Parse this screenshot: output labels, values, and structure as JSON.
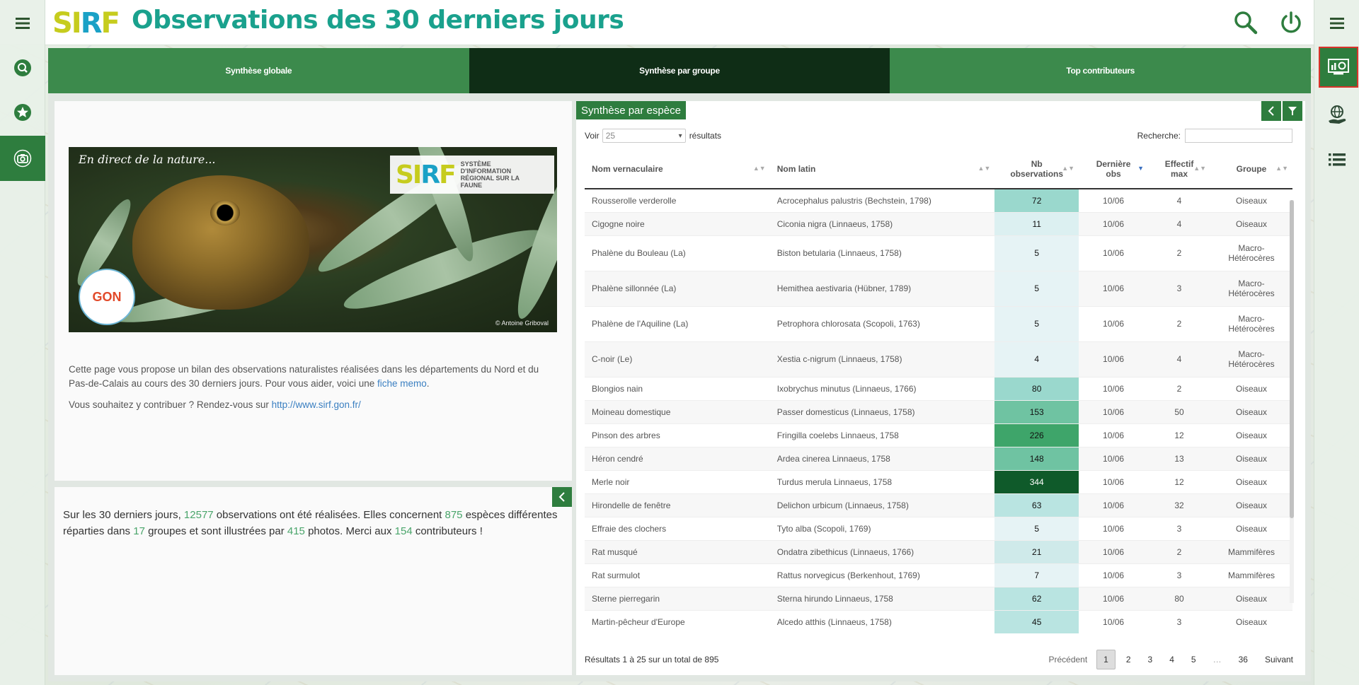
{
  "header": {
    "logo_text": "SIRF",
    "title": "Observations des 30 derniers jours"
  },
  "tabs": [
    {
      "label": "Synthèse globale"
    },
    {
      "label": "Synthèse par groupe"
    },
    {
      "label": "Top contributeurs"
    }
  ],
  "banner": {
    "caption": "En direct de la nature...",
    "sirf_subtitle": "SYSTÈME D'INFORMATION RÉGIONAL SUR LA FAUNE",
    "gon_label": "GON",
    "credit": "© Antoine Griboval"
  },
  "intro": {
    "line1": "Cette page vous propose un bilan des observations naturalistes réalisées dans les départements du Nord et du Pas-de-Calais au cours des 30 derniers jours. Pour vous aider, voici une ",
    "link1": "fiche memo",
    "line1_end": ".",
    "line2": "Vous souhaitez y contribuer ? Rendez-vous sur ",
    "link2": "http://www.sirf.gon.fr/"
  },
  "stats": {
    "t1": "Sur les 30 derniers jours, ",
    "observations": "12577",
    "t2": " observations ont été réalisées. Elles concernent ",
    "especes": "875",
    "t3": " espèces différentes réparties dans ",
    "groupes": "17",
    "t4": " groupes et sont illustrées par ",
    "photos": "415",
    "t5": " photos. Merci aux ",
    "contributeurs": "154",
    "t6": " contributeurs !"
  },
  "table_panel": {
    "title": "Synthèse par espèce",
    "voir_label": "Voir",
    "page_size": "25",
    "resultats_label": "résultats",
    "search_label": "Recherche:",
    "columns": [
      "Nom vernaculaire",
      "Nom latin",
      "Nb observations",
      "Dernière obs",
      "Effectif max",
      "Groupe"
    ],
    "rows": [
      {
        "nom": "Rousserolle verderolle",
        "latin": "Acrocephalus palustris (Bechstein, 1798)",
        "nb": 72,
        "obs": "10/06",
        "eff": "4",
        "groupe": "Oiseaux"
      },
      {
        "nom": "Cigogne noire",
        "latin": "Ciconia nigra (Linnaeus, 1758)",
        "nb": 11,
        "obs": "10/06",
        "eff": "4",
        "groupe": "Oiseaux"
      },
      {
        "nom": "Phalène du Bouleau (La)",
        "latin": "Biston betularia (Linnaeus, 1758)",
        "nb": 5,
        "obs": "10/06",
        "eff": "2",
        "groupe": "Macro-Hétérocères"
      },
      {
        "nom": "Phalène sillonnée (La)",
        "latin": "Hemithea aestivaria (Hübner, 1789)",
        "nb": 5,
        "obs": "10/06",
        "eff": "3",
        "groupe": "Macro-Hétérocères"
      },
      {
        "nom": "Phalène de l'Aquiline (La)",
        "latin": "Petrophora chlorosata (Scopoli, 1763)",
        "nb": 5,
        "obs": "10/06",
        "eff": "2",
        "groupe": "Macro-Hétérocères"
      },
      {
        "nom": "C-noir (Le)",
        "latin": "Xestia c-nigrum (Linnaeus, 1758)",
        "nb": 4,
        "obs": "10/06",
        "eff": "4",
        "groupe": "Macro-Hétérocères"
      },
      {
        "nom": "Blongios nain",
        "latin": "Ixobrychus minutus (Linnaeus, 1766)",
        "nb": 80,
        "obs": "10/06",
        "eff": "2",
        "groupe": "Oiseaux"
      },
      {
        "nom": "Moineau domestique",
        "latin": "Passer domesticus (Linnaeus, 1758)",
        "nb": 153,
        "obs": "10/06",
        "eff": "50",
        "groupe": "Oiseaux"
      },
      {
        "nom": "Pinson des arbres",
        "latin": "Fringilla coelebs Linnaeus, 1758",
        "nb": 226,
        "obs": "10/06",
        "eff": "12",
        "groupe": "Oiseaux"
      },
      {
        "nom": "Héron cendré",
        "latin": "Ardea cinerea Linnaeus, 1758",
        "nb": 148,
        "obs": "10/06",
        "eff": "13",
        "groupe": "Oiseaux"
      },
      {
        "nom": "Merle noir",
        "latin": "Turdus merula Linnaeus, 1758",
        "nb": 344,
        "obs": "10/06",
        "eff": "12",
        "groupe": "Oiseaux"
      },
      {
        "nom": "Hirondelle de fenêtre",
        "latin": "Delichon urbicum (Linnaeus, 1758)",
        "nb": 63,
        "obs": "10/06",
        "eff": "32",
        "groupe": "Oiseaux"
      },
      {
        "nom": "Effraie des clochers",
        "latin": "Tyto alba (Scopoli, 1769)",
        "nb": 5,
        "obs": "10/06",
        "eff": "3",
        "groupe": "Oiseaux"
      },
      {
        "nom": "Rat musqué",
        "latin": "Ondatra zibethicus (Linnaeus, 1766)",
        "nb": 21,
        "obs": "10/06",
        "eff": "2",
        "groupe": "Mammifères"
      },
      {
        "nom": "Rat surmulot",
        "latin": "Rattus norvegicus (Berkenhout, 1769)",
        "nb": 7,
        "obs": "10/06",
        "eff": "3",
        "groupe": "Mammifères"
      },
      {
        "nom": "Sterne pierregarin",
        "latin": "Sterna hirundo Linnaeus, 1758",
        "nb": 62,
        "obs": "10/06",
        "eff": "80",
        "groupe": "Oiseaux"
      },
      {
        "nom": "Martin-pêcheur d'Europe",
        "latin": "Alcedo atthis (Linnaeus, 1758)",
        "nb": 45,
        "obs": "10/06",
        "eff": "3",
        "groupe": "Oiseaux"
      }
    ],
    "footer_text": "Résultats 1 à 25 sur un total de 895",
    "pager": {
      "prev": "Précédent",
      "pages": [
        "1",
        "2",
        "3",
        "4",
        "5",
        "…",
        "36"
      ],
      "next": "Suivant"
    }
  },
  "colors": {
    "brand_green": "#2e7d3e",
    "active_tab": "#0f2d16",
    "title_teal": "#1aa18d",
    "stat_number": "#4aa56b"
  }
}
